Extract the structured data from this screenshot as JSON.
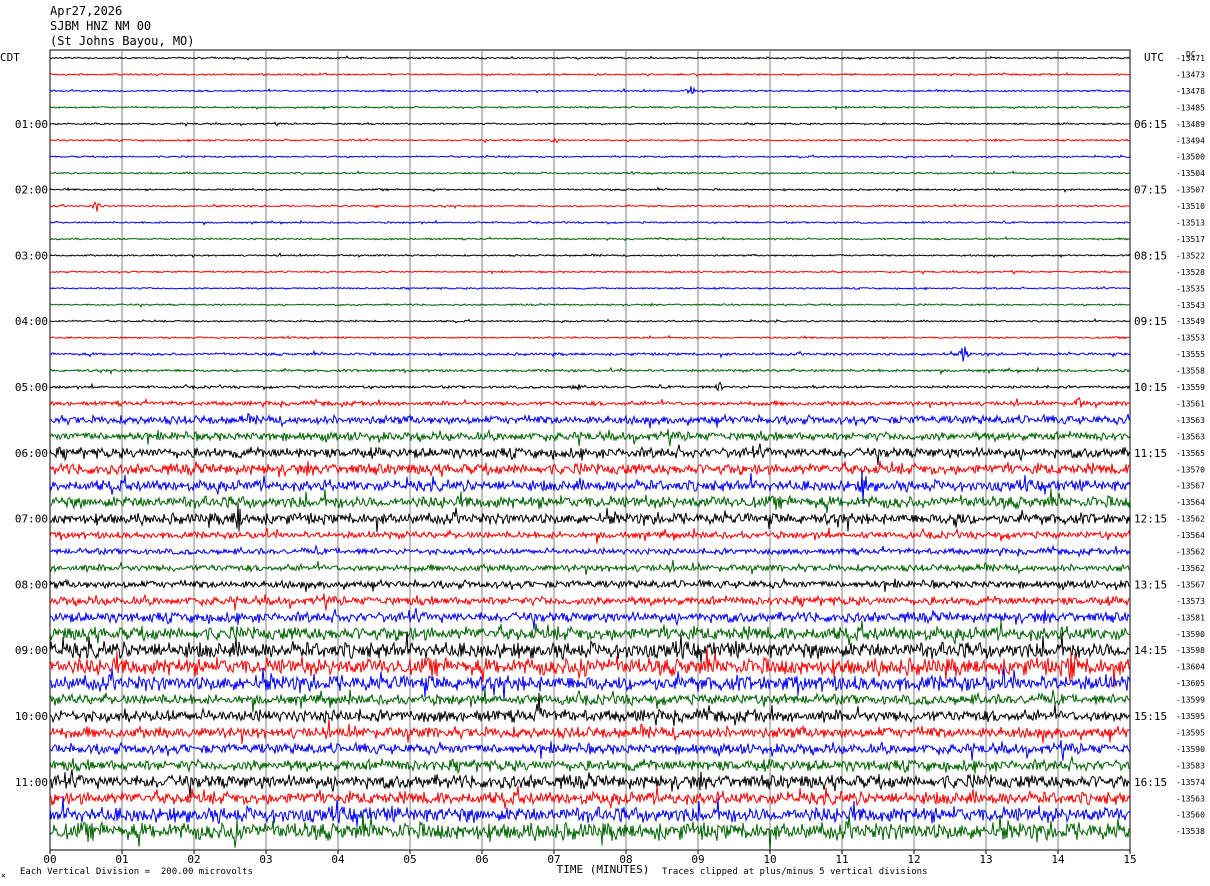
{
  "header": {
    "date": "Apr27,2026",
    "station": "SJBM HNZ NM 00",
    "location": "(St Johns Bayou, MO)"
  },
  "footer": {
    "scale_note": "Each Vertical Division =  200.00 microvolts",
    "clip_note": "Traces clipped at plus/minus 5 vertical divisions",
    "corner_mark": "×"
  },
  "colors": {
    "cycle": [
      "#000000",
      "#ff0000",
      "#0000ff",
      "#006400"
    ],
    "grid": "#808080"
  },
  "chart_data": {
    "type": "line",
    "title": "",
    "left_axis_label": "CDT",
    "right_axis_label": "UTC",
    "right_top_label": "DC",
    "xlabel": "TIME (MINUTES)",
    "xlim": [
      0,
      15
    ],
    "x_ticks": [
      "00",
      "01",
      "02",
      "03",
      "04",
      "05",
      "06",
      "07",
      "08",
      "09",
      "10",
      "11",
      "12",
      "13",
      "14",
      "15"
    ],
    "grid": true,
    "rows_per_hour": 4,
    "left_hour_labels": [
      "01:00",
      "02:00",
      "03:00",
      "04:00",
      "05:00",
      "06:00",
      "07:00",
      "08:00",
      "09:00",
      "10:00",
      "11:00"
    ],
    "right_hour_labels": [
      "06:15",
      "07:15",
      "08:15",
      "09:15",
      "10:15",
      "11:15",
      "12:15",
      "13:15",
      "14:15",
      "15:15",
      "16:15"
    ],
    "dc_offsets": [
      "-13471",
      "-13473",
      "-13478",
      "-13485",
      "-13489",
      "-13494",
      "-13500",
      "-13504",
      "-13507",
      "-13510",
      "-13513",
      "-13517",
      "-13522",
      "-13528",
      "-13535",
      "-13543",
      "-13549",
      "-13553",
      "-13555",
      "-13558",
      "-13559",
      "-13561",
      "-13563",
      "-13563",
      "-13565",
      "-13570",
      "-13567",
      "-13564",
      "-13562",
      "-13564",
      "-13562",
      "-13562",
      "-13567",
      "-13573",
      "-13581",
      "-13590",
      "-13598",
      "-13604",
      "-13605",
      "-13599",
      "-13595",
      "-13595",
      "-13590",
      "-13583",
      "-13574",
      "-13563",
      "-13560",
      "-13538"
    ],
    "trace_amplitude": [
      1,
      1,
      1,
      1,
      1,
      1,
      1,
      1,
      1,
      1,
      1,
      1,
      1,
      1,
      1,
      1,
      1,
      1,
      1.5,
      1.5,
      1.5,
      2.5,
      5,
      5,
      6,
      6.5,
      6.5,
      7,
      6.5,
      4,
      3.5,
      4,
      4.5,
      5,
      6,
      8,
      9.5,
      10,
      9,
      6,
      7,
      6.5,
      6,
      6.5,
      8,
      7.5,
      9,
      10
    ],
    "trace_events": [
      {
        "trace": 2,
        "minute": 8.9,
        "amp": 5
      },
      {
        "trace": 5,
        "minute": 7.0,
        "amp": 3
      },
      {
        "trace": 9,
        "minute": 0.65,
        "amp": 5
      },
      {
        "trace": 18,
        "minute": 12.7,
        "amp": 10
      },
      {
        "trace": 20,
        "minute": 7.3,
        "amp": 4
      },
      {
        "trace": 20,
        "minute": 9.3,
        "amp": 4
      },
      {
        "trace": 21,
        "minute": 14.3,
        "amp": 6
      },
      {
        "trace": 26,
        "minute": 11.3,
        "amp": 14
      },
      {
        "trace": 28,
        "minute": 2.6,
        "amp": 14
      },
      {
        "trace": 28,
        "minute": 12.6,
        "amp": 10
      },
      {
        "trace": 37,
        "minute": 7.4,
        "amp": 18
      },
      {
        "trace": 37,
        "minute": 14.2,
        "amp": 14
      },
      {
        "trace": 40,
        "minute": 6.8,
        "amp": 14
      },
      {
        "trace": 47,
        "minute": 2.6,
        "amp": 20
      }
    ]
  }
}
